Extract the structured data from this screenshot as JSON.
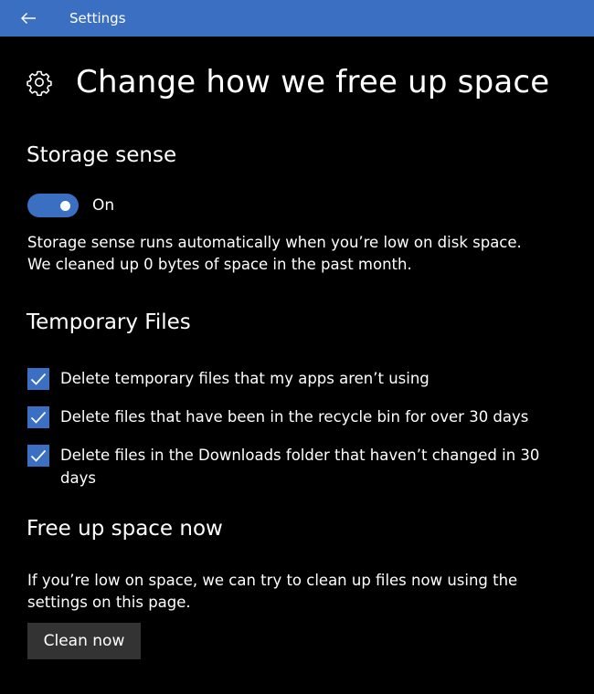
{
  "window": {
    "title": "Settings",
    "accent_color": "#3b6fc2"
  },
  "page": {
    "title": "Change how we free up space",
    "icon": "gear-icon"
  },
  "storage_sense": {
    "heading": "Storage sense",
    "toggle_state": "On",
    "toggle_on": true,
    "description_line1": "Storage sense runs automatically when you’re low on disk space.",
    "description_line2": "We cleaned up 0 bytes of space in the past month."
  },
  "temporary_files": {
    "heading": "Temporary Files",
    "options": [
      {
        "label": "Delete temporary files that my apps aren’t using",
        "checked": true
      },
      {
        "label": "Delete files that have been in the recycle bin for over 30 days",
        "checked": true
      },
      {
        "label": "Delete files in the Downloads folder that haven’t changed in 30 days",
        "checked": true
      }
    ]
  },
  "free_up_now": {
    "heading": "Free up space now",
    "description": "If you’re low on space, we can try to clean up files now using the settings on this page.",
    "button_label": "Clean now"
  }
}
